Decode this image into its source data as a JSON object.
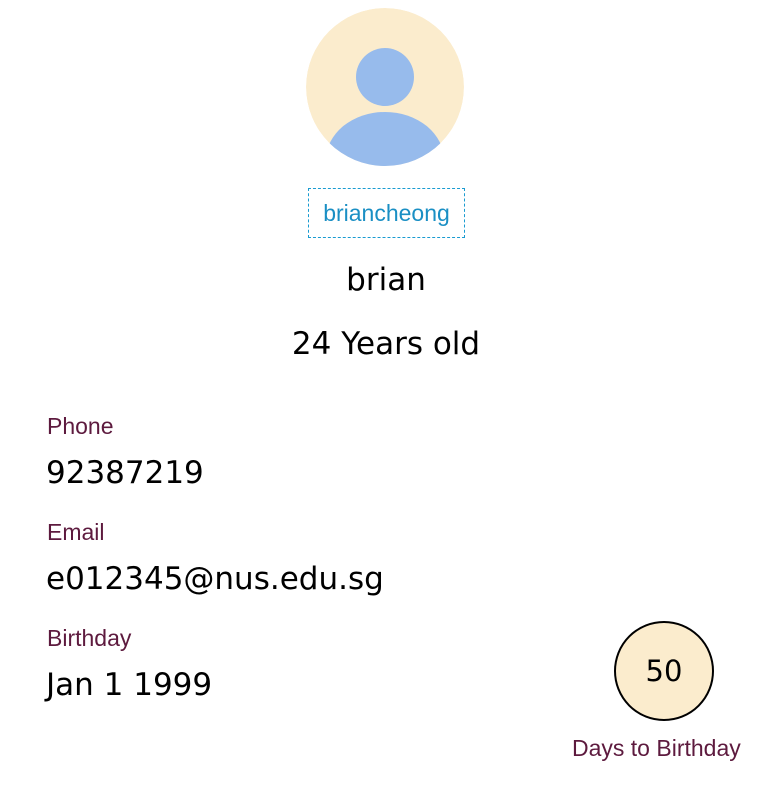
{
  "profile": {
    "username": "briancheong",
    "name": "brian",
    "age_text": "24 Years old"
  },
  "fields": {
    "phone": {
      "label": "Phone",
      "value": "92387219"
    },
    "email": {
      "label": "Email",
      "value": "e012345@nus.edu.sg"
    },
    "birthday": {
      "label": "Birthday",
      "value": "Jan 1 1999"
    }
  },
  "countdown": {
    "days": "50",
    "label": "Days to Birthday"
  },
  "colors": {
    "avatar_bg": "#fbeccd",
    "avatar_figure": "#97bbec",
    "username_link": "#1a8fc4",
    "label": "#5d1a3e",
    "countdown_bg": "#fbeccd"
  },
  "icons": {
    "avatar": "user-avatar-icon"
  }
}
